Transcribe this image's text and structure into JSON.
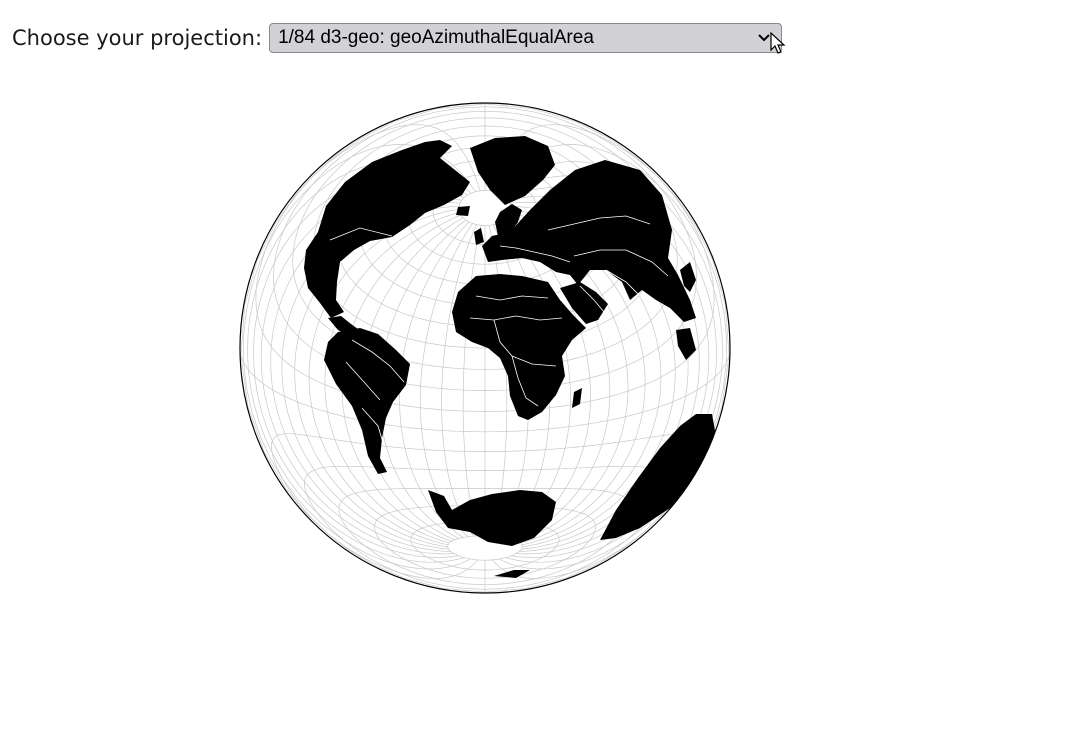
{
  "controls": {
    "label": "Choose your projection:",
    "selected": "1/84 d3-geo: geoAzimuthalEqualArea"
  },
  "icons": {
    "dropdown": "chevron-down-icon",
    "cursor": "mouse-pointer-icon"
  },
  "colors": {
    "land": "#000000",
    "graticule": "#c8c8c8",
    "borders": "#ffffff",
    "sphere_outline": "#000000",
    "select_bg": "#d2d2d6"
  }
}
